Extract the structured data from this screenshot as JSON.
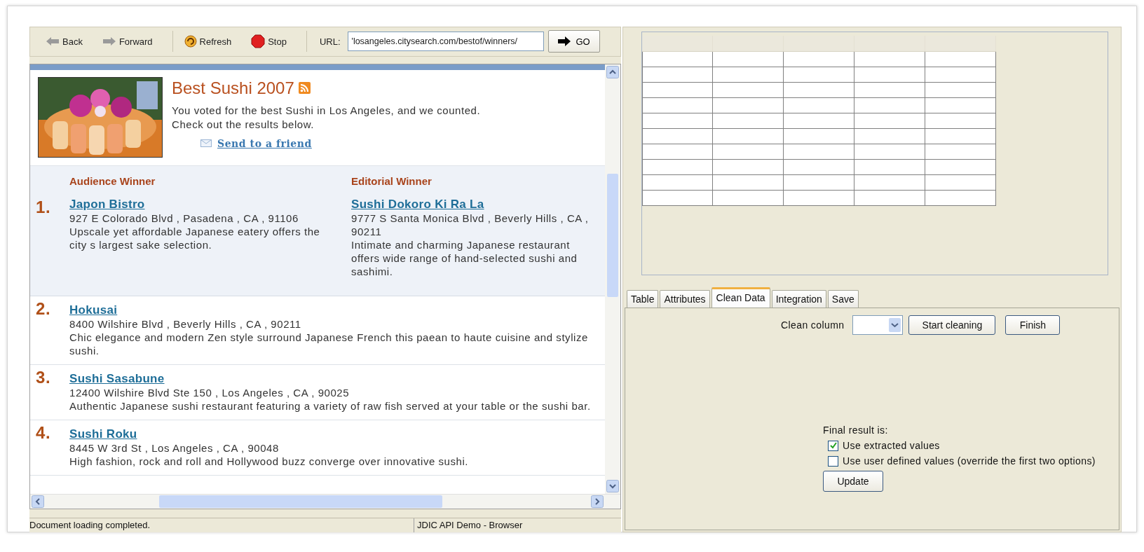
{
  "toolbar": {
    "buttons": [
      {
        "kind": "back",
        "label": "Back"
      },
      {
        "kind": "forward",
        "label": "Forward"
      },
      {
        "kind": "refresh",
        "label": "Refresh"
      },
      {
        "kind": "stop",
        "label": "Stop"
      }
    ],
    "url_label": "URL:",
    "url": "'losangeles.citysearch.com/bestof/winners/",
    "go": "GO"
  },
  "page": {
    "title": "Best Sushi 2007",
    "intro": [
      "You voted for the best Sushi in Los Angeles, and we counted.",
      "Check out the results below."
    ],
    "send_link": "Send to a friend",
    "winners": {
      "rank": "1.",
      "columns": [
        {
          "heading": "Audience Winner",
          "name": "Japon Bistro",
          "address": "927 E Colorado Blvd , Pasadena , CA , 91106",
          "description": "Upscale yet affordable Japanese eatery offers the city s largest sake selection."
        },
        {
          "heading": "Editorial Winner",
          "name": "Sushi Dokoro Ki Ra La",
          "address": "9777 S Santa Monica Blvd , Beverly Hills , CA , 90211",
          "description": "Intimate and charming Japanese restaurant offers wide range of hand-selected sushi and sashimi."
        }
      ]
    },
    "results": [
      {
        "rank": "2.",
        "name": "Hokusai",
        "address": "8400 Wilshire Blvd , Beverly Hills , CA , 90211",
        "description_lines": [
          "Chic elegance and modern Zen style surround Japanese French this paean to haute cuisine and stylize",
          "sushi."
        ]
      },
      {
        "rank": "3.",
        "name": "Sushi Sasabune",
        "address": "12400 Wilshire Blvd Ste 150 , Los Angeles , CA , 90025",
        "description_lines": [
          "Authentic Japanese sushi restaurant featuring a variety of raw fish served at your table or the sushi bar."
        ]
      },
      {
        "rank": "4.",
        "name": "Sushi Roku",
        "address": "8445 W 3rd St , Los Angeles , CA , 90048",
        "description_lines": [
          "High fashion, rock and roll and Hollywood buzz converge over innovative sushi."
        ]
      }
    ]
  },
  "status_bar": [
    "Document loading completed.",
    "JDIC API Demo - Browser"
  ],
  "tabs": [
    {
      "label": "Table",
      "selected": false
    },
    {
      "label": "Attributes",
      "selected": false
    },
    {
      "label": "Clean Data",
      "selected": true
    },
    {
      "label": "Integration",
      "selected": false
    },
    {
      "label": "Save",
      "selected": false
    }
  ],
  "clean": {
    "label": "Clean column",
    "buttons": [
      "Start cleaning",
      "Finish"
    ],
    "final_label": "Final result is:",
    "options": [
      {
        "label": "Use extracted values",
        "checked": true
      },
      {
        "label": "Use user defined values (override the first two options)",
        "checked": false
      }
    ],
    "update": "Update"
  }
}
